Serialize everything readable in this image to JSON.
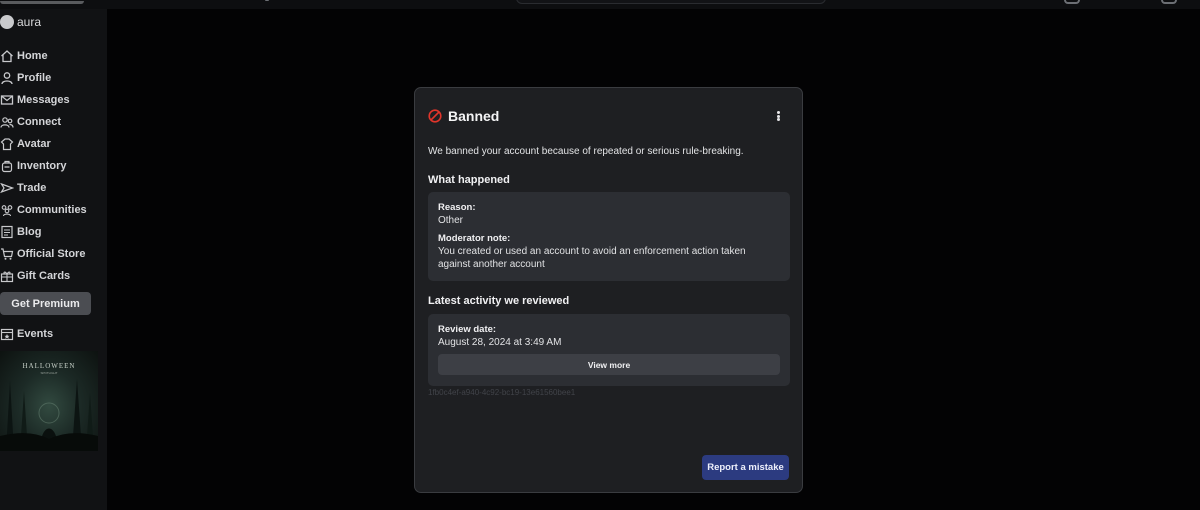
{
  "sidebar": {
    "username": "aura",
    "items": [
      {
        "label": "Home",
        "icon": "home-icon"
      },
      {
        "label": "Profile",
        "icon": "profile-icon"
      },
      {
        "label": "Messages",
        "icon": "messages-icon"
      },
      {
        "label": "Connect",
        "icon": "connect-icon"
      },
      {
        "label": "Avatar",
        "icon": "avatar-icon"
      },
      {
        "label": "Inventory",
        "icon": "inventory-icon"
      },
      {
        "label": "Trade",
        "icon": "trade-icon"
      },
      {
        "label": "Communities",
        "icon": "communities-icon"
      },
      {
        "label": "Blog",
        "icon": "blog-icon"
      },
      {
        "label": "Official Store",
        "icon": "store-icon"
      },
      {
        "label": "Gift Cards",
        "icon": "gift-card-icon"
      }
    ],
    "premium_label": "Get Premium",
    "events_label": "Events",
    "promo": {
      "title": "HALLOWEEN",
      "subtitle": "SPOTLIGHT"
    }
  },
  "modal": {
    "title": "Banned",
    "description": "We banned your account because of repeated or serious rule-breaking.",
    "what_happened": {
      "heading": "What happened",
      "reason_label": "Reason:",
      "reason_value": "Other",
      "note_label": "Moderator note:",
      "note_value": "You created or used an account to avoid an enforcement action taken against another account"
    },
    "activity": {
      "heading": "Latest activity we reviewed",
      "date_label": "Review date:",
      "date_value": "August 28, 2024 at 3:49 AM",
      "view_more_label": "View more"
    },
    "case_id": "1fb0c4ef-a940-4c92-bc19-13e61560bee1",
    "report_label": "Report a mistake"
  },
  "colors": {
    "accent_button": "#2c3b80",
    "ban_icon": "#e0352b",
    "modal_bg": "#1e1f22",
    "card_bg": "#2c2e33"
  }
}
